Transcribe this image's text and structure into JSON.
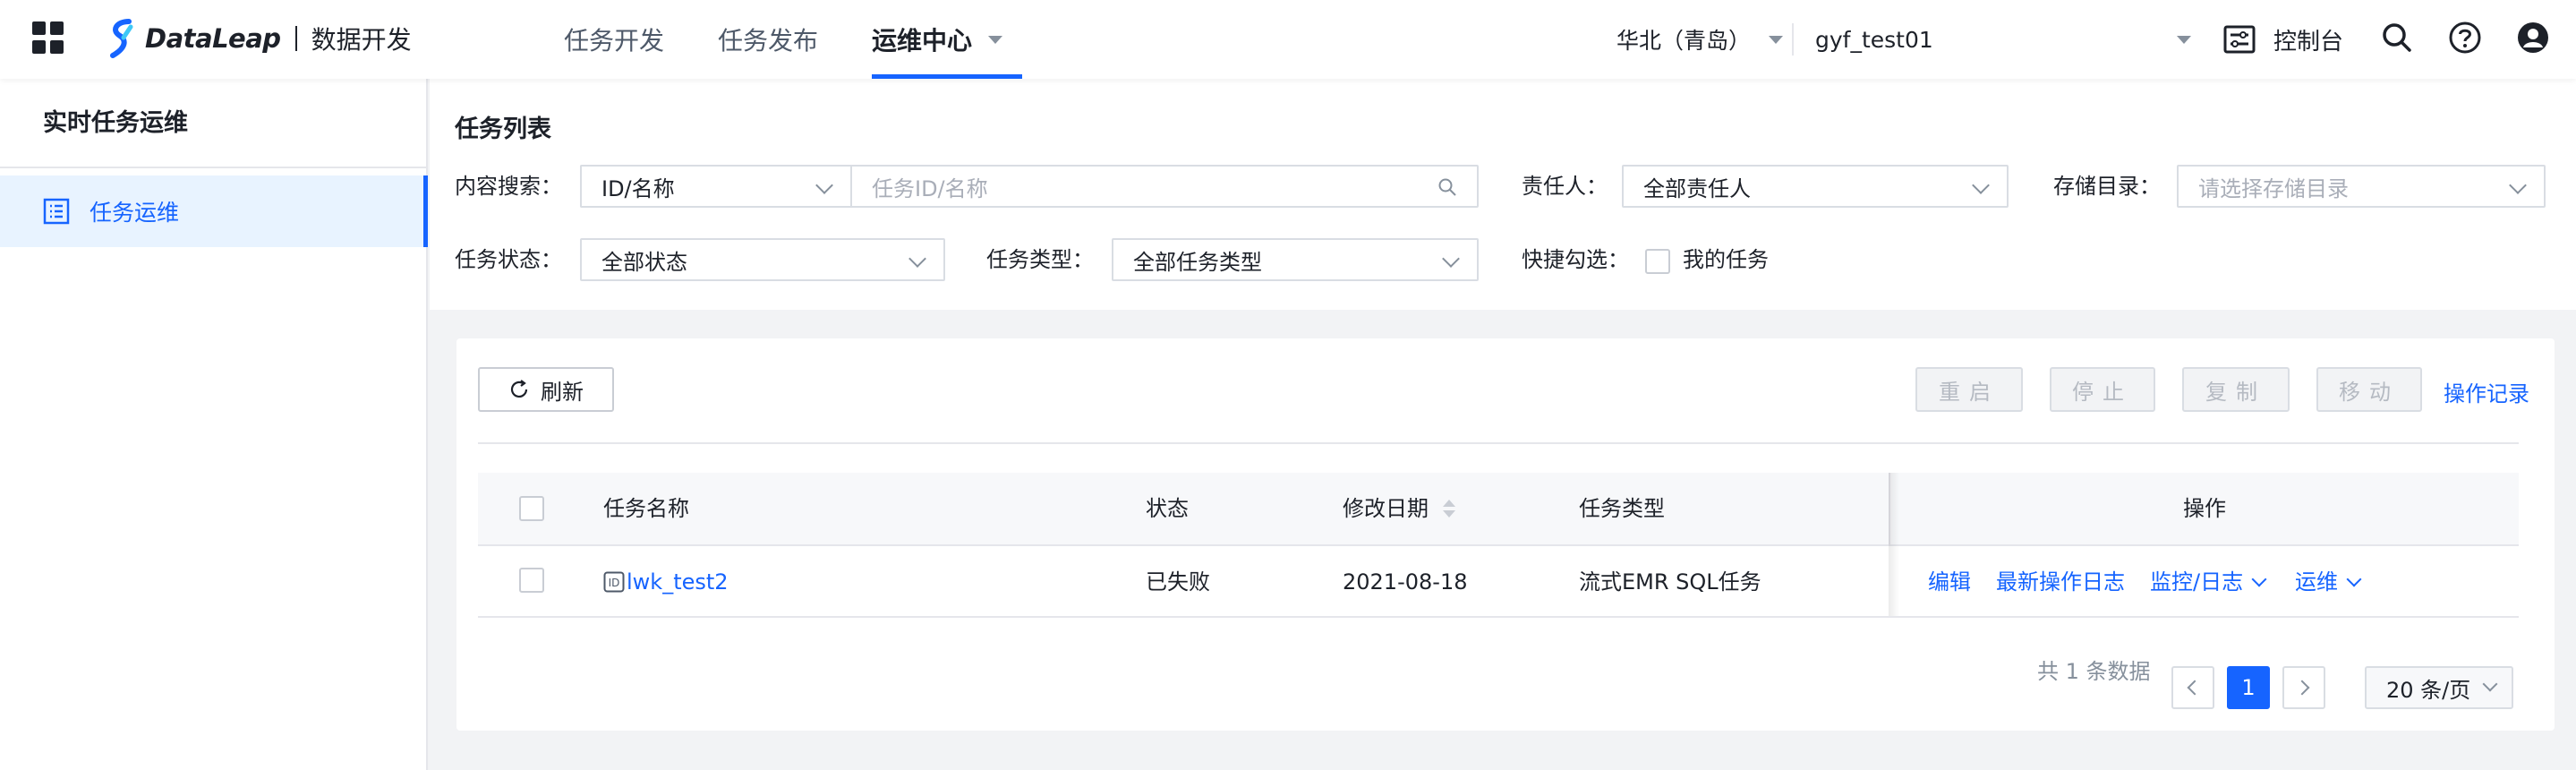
{
  "header": {
    "logo_text": "DataLeap",
    "product": "数据开发",
    "tabs": [
      {
        "label": "任务开发"
      },
      {
        "label": "任务发布"
      },
      {
        "label": "运维中心"
      }
    ],
    "region": "华北（青岛）",
    "project": "gyf_test01",
    "console": "控制台",
    "icons": [
      "apps-grid-icon",
      "search-icon",
      "help-icon",
      "user-icon"
    ]
  },
  "sidebar": {
    "title": "实时任务运维",
    "items": [
      {
        "label": "任务运维",
        "icon": "task-list-icon"
      }
    ]
  },
  "filters": {
    "title": "任务列表",
    "content_search_label": "内容搜索：",
    "search_type": "ID/名称",
    "search_placeholder": "任务ID/名称",
    "owner_label": "责任人：",
    "owner_value": "全部责任人",
    "storage_label": "存储目录：",
    "storage_placeholder": "请选择存储目录",
    "status_label": "任务状态：",
    "status_value": "全部状态",
    "type_label": "任务类型：",
    "type_value": "全部任务类型",
    "quick_label": "快捷勾选：",
    "my_tasks": "我的任务"
  },
  "toolbar": {
    "refresh": "刷新",
    "restart": "重启",
    "stop": "停止",
    "copy": "复制",
    "move": "移动",
    "op_log": "操作记录"
  },
  "table": {
    "columns": [
      "任务名称",
      "状态",
      "修改日期",
      "任务类型",
      "操作"
    ],
    "rows": [
      {
        "name": "lwk_test2",
        "status": "已失败",
        "modified": "2021-08-18",
        "type": "流式EMR SQL任务",
        "actions": [
          "编辑",
          "最新操作日志",
          "监控/日志",
          "运维"
        ]
      }
    ]
  },
  "pagination": {
    "total_text": "共 1 条数据",
    "current_page": "1",
    "page_size": "20 条/页"
  },
  "colors": {
    "accent": "#1664ff",
    "active_bg": "#e8f3ff"
  }
}
